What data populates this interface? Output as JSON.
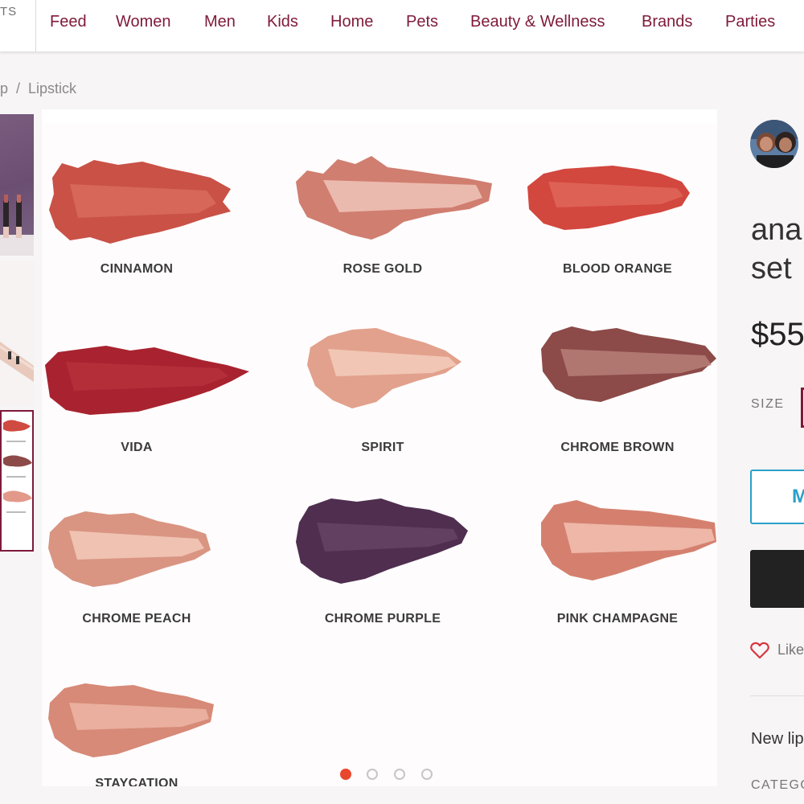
{
  "nav": {
    "edge_label": "TS",
    "items": [
      "Feed",
      "Women",
      "Men",
      "Kids",
      "Home",
      "Pets",
      "Beauty & Wellness",
      "Brands",
      "Parties"
    ]
  },
  "breadcrumb": {
    "prev": "p",
    "separator": "/",
    "current": "Lipstick"
  },
  "gallery": {
    "swatches": [
      {
        "label": "CINNAMON",
        "color": "#c95146"
      },
      {
        "label": "ROSE GOLD",
        "color": "#e0a092"
      },
      {
        "label": "BLOOD ORANGE",
        "color": "#d2473e"
      },
      {
        "label": "VIDA",
        "color": "#a8232f"
      },
      {
        "label": "SPIRIT",
        "color": "#e8b09c"
      },
      {
        "label": "CHROME BROWN",
        "color": "#8c4a48"
      },
      {
        "label": "CHROME PEACH",
        "color": "#dca08d"
      },
      {
        "label": "CHROME PURPLE",
        "color": "#4f2e4f"
      },
      {
        "label": "PINK CHAMPAGNE",
        "color": "#e3998a"
      },
      {
        "label": "STAYCATION",
        "color": "#d68a77"
      }
    ],
    "page_count": 4,
    "active_page": 1
  },
  "product": {
    "title_line1": "ana",
    "title_line2": "set",
    "price": "$55",
    "size_label": "SIZE",
    "primary_button_label": "M",
    "like_label": "Like",
    "description": "New lip",
    "category_label": "CATEGO"
  },
  "colors": {
    "brand": "#7f1a3a",
    "accent_blue": "#2aa0c9",
    "active_dot": "#e8472e"
  }
}
